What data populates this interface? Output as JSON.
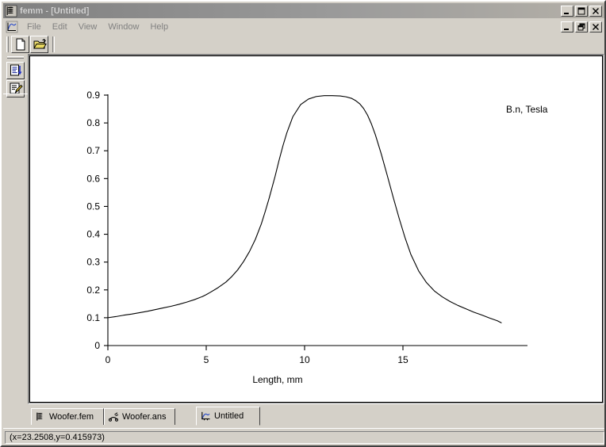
{
  "window": {
    "title": "femm - [Untitled]",
    "title_icon": "femm-coil-icon",
    "controls": [
      {
        "name": "minimize",
        "glyph": "_"
      },
      {
        "name": "maximize",
        "glyph": "[]"
      },
      {
        "name": "close",
        "glyph": "X"
      }
    ],
    "child_controls": [
      {
        "name": "child-minimize",
        "glyph": "_"
      },
      {
        "name": "child-restore",
        "glyph": "restore"
      },
      {
        "name": "child-close",
        "glyph": "X"
      }
    ]
  },
  "menu": {
    "mdi_icon": "plot-window-icon",
    "items": [
      {
        "label": "File"
      },
      {
        "label": "Edit"
      },
      {
        "label": "View"
      },
      {
        "label": "Window"
      },
      {
        "label": "Help"
      }
    ]
  },
  "toolbar": {
    "buttons": [
      {
        "name": "new-document-button",
        "icon": "new-document-icon",
        "tooltip": "New"
      },
      {
        "name": "open-document-button",
        "icon": "open-folder-icon",
        "tooltip": "Open"
      }
    ]
  },
  "left_toolbar": {
    "buttons": [
      {
        "name": "export-data-button",
        "icon": "document-down-arrow-icon",
        "tooltip": "Export data"
      },
      {
        "name": "edit-plot-button",
        "icon": "document-pencil-icon",
        "tooltip": "Edit plot"
      }
    ]
  },
  "tabs": [
    {
      "label": "Woofer.fem",
      "icon": "femm-coil-icon",
      "active": false
    },
    {
      "label": "Woofer.ans",
      "icon": "magnet-icon",
      "active": false
    },
    {
      "label": "Untitled",
      "icon": "plot-window-icon",
      "active": true
    }
  ],
  "status": {
    "coordinates": "(x=23.2508,y=0.415973)"
  },
  "colors": {
    "face": "#d4d0c8",
    "title_start": "#808080",
    "title_end": "#b4b0a8",
    "plot_bg": "#ffffff",
    "curve": "#000000",
    "axis": "#000000",
    "menu_text": "#808080"
  },
  "chart_data": {
    "type": "line",
    "title": "",
    "xlabel": "Length, mm",
    "ylabel": "",
    "legend": "B.n, Tesla",
    "legend_position": "top-right",
    "grid": false,
    "xlim": [
      0,
      20
    ],
    "ylim": [
      0,
      0.9
    ],
    "xticks": [
      0,
      5,
      10,
      15
    ],
    "xticklabels": [
      "0",
      "5",
      "10",
      "15"
    ],
    "yticks": [
      0,
      0.1,
      0.2,
      0.3,
      0.4,
      0.5,
      0.6,
      0.7,
      0.8,
      0.9
    ],
    "yticklabels": [
      "0",
      "0.1",
      "0.2",
      "0.3",
      "0.4",
      "0.5",
      "0.6",
      "0.7",
      "0.8",
      "0.9"
    ],
    "series": [
      {
        "name": "B.n, Tesla",
        "x": [
          0.0,
          0.4,
          0.8,
          1.2,
          1.6,
          2.0,
          2.4,
          2.8,
          3.2,
          3.6,
          4.0,
          4.4,
          4.8,
          5.0,
          5.2,
          5.6,
          6.0,
          6.3,
          6.6,
          6.9,
          7.2,
          7.5,
          7.8,
          8.0,
          8.2,
          8.5,
          8.7,
          8.9,
          9.1,
          9.4,
          9.8,
          10.2,
          10.6,
          11.0,
          11.4,
          11.8,
          12.1,
          12.4,
          12.6,
          12.8,
          13.0,
          13.2,
          13.4,
          13.6,
          13.9,
          14.2,
          14.5,
          14.8,
          15.1,
          15.4,
          15.8,
          16.2,
          16.6,
          17.0,
          17.4,
          17.8,
          18.2,
          18.6,
          19.0,
          19.4,
          19.8,
          20.0
        ],
        "y": [
          0.1,
          0.104,
          0.109,
          0.113,
          0.118,
          0.123,
          0.129,
          0.135,
          0.141,
          0.148,
          0.156,
          0.165,
          0.176,
          0.183,
          0.191,
          0.208,
          0.228,
          0.248,
          0.272,
          0.302,
          0.338,
          0.382,
          0.437,
          0.482,
          0.53,
          0.608,
          0.665,
          0.718,
          0.765,
          0.822,
          0.866,
          0.886,
          0.895,
          0.898,
          0.898,
          0.897,
          0.894,
          0.888,
          0.88,
          0.869,
          0.852,
          0.828,
          0.796,
          0.757,
          0.688,
          0.612,
          0.534,
          0.459,
          0.389,
          0.328,
          0.268,
          0.226,
          0.196,
          0.175,
          0.158,
          0.144,
          0.132,
          0.12,
          0.11,
          0.099,
          0.089,
          0.082
        ]
      }
    ]
  }
}
